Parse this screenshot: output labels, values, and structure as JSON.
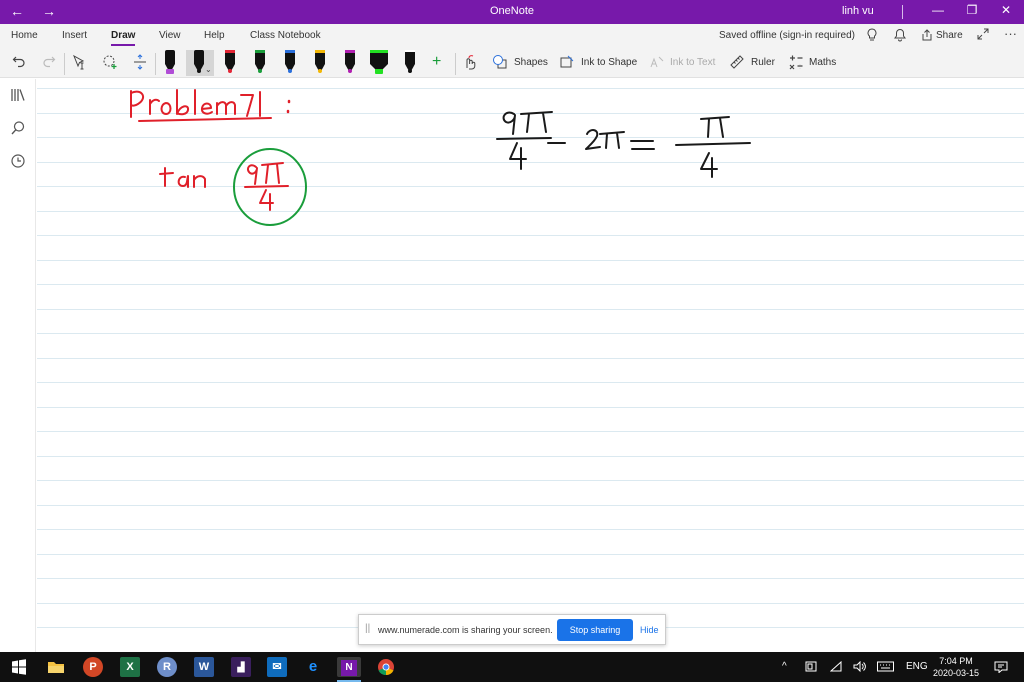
{
  "titlebar": {
    "back": "←",
    "forward": "→",
    "title": "OneNote",
    "user": "linh vu",
    "minimize": "—",
    "restore": "❐",
    "close": "✕"
  },
  "tabs": [
    "Home",
    "Insert",
    "Draw",
    "View",
    "Help",
    "Class Notebook"
  ],
  "active_tab": "Draw",
  "status": {
    "saved": "Saved offline (sign-in required)",
    "share": "Share"
  },
  "toolbar": {
    "shapes": "Shapes",
    "ink_to_shape": "Ink to Shape",
    "ink_to_text": "Ink to Text",
    "ruler": "Ruler",
    "maths": "Maths",
    "pens": [
      {
        "color": "#b04cd6",
        "kind": "highlighter"
      },
      {
        "color": "#111111",
        "kind": "pen",
        "selected": true
      },
      {
        "color": "#e32636",
        "kind": "pen"
      },
      {
        "color": "#1a9d3b",
        "kind": "pen"
      },
      {
        "color": "#2a6fdb",
        "kind": "pen"
      },
      {
        "color": "#f2b705",
        "kind": "pen"
      },
      {
        "color": "#b01fb0",
        "kind": "pen"
      },
      {
        "color": "#22e022",
        "kind": "highlighter"
      },
      {
        "color": "#111111",
        "kind": "pen"
      }
    ]
  },
  "ink": {
    "red_color": "#e0202a",
    "green_color": "#1a9d3b",
    "black_color": "#1a1a1a"
  },
  "banner": {
    "message": "www.numerade.com is sharing your screen.",
    "stop": "Stop sharing",
    "hide": "Hide"
  },
  "taskbar": {
    "language": "ENG",
    "time": "7:04 PM",
    "date": "2020-03-15"
  }
}
